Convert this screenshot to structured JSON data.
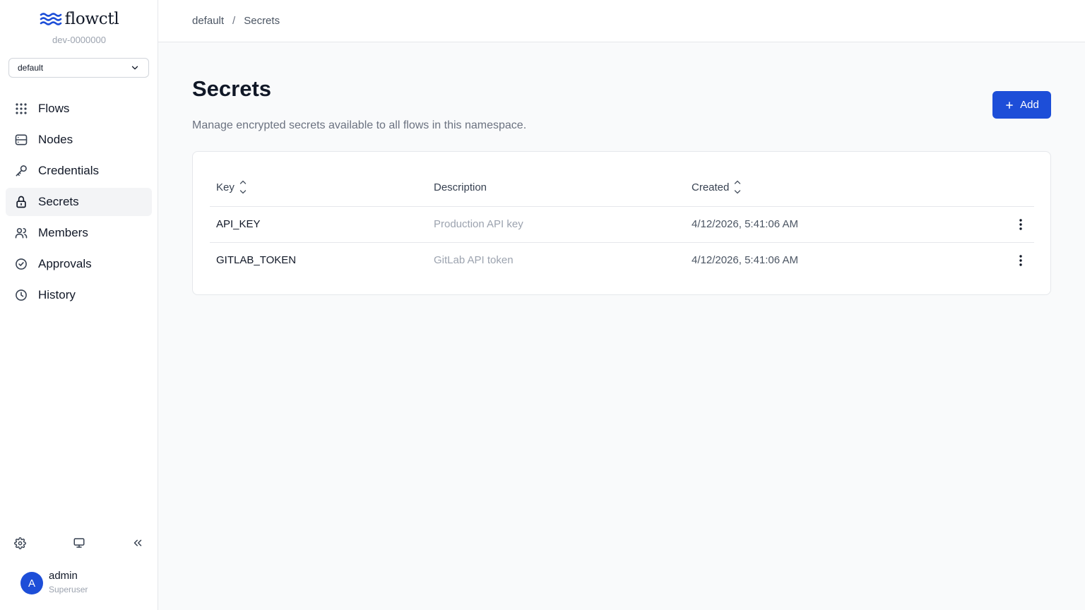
{
  "app": {
    "name": "flowctl",
    "instance": "dev-0000000"
  },
  "namespace_select": {
    "value": "default"
  },
  "nav": [
    {
      "label": "Flows",
      "icon": "grid-dots-icon"
    },
    {
      "label": "Nodes",
      "icon": "server-icon"
    },
    {
      "label": "Credentials",
      "icon": "key-icon"
    },
    {
      "label": "Secrets",
      "icon": "lock-icon",
      "active": true
    },
    {
      "label": "Members",
      "icon": "users-icon"
    },
    {
      "label": "Approvals",
      "icon": "check-circle-icon"
    },
    {
      "label": "History",
      "icon": "clock-icon"
    }
  ],
  "footer": {
    "icons": [
      "gear-icon",
      "monitor-icon",
      "collapse-sidebar-icon"
    ]
  },
  "user": {
    "initial": "A",
    "name": "admin",
    "role": "Superuser"
  },
  "breadcrumb": {
    "root": "default",
    "separator": "/",
    "current": "Secrets"
  },
  "page": {
    "title": "Secrets",
    "description": "Manage encrypted secrets available to all flows in this namespace.",
    "add_label": "Add"
  },
  "table": {
    "columns": {
      "key": "Key",
      "description": "Description",
      "created": "Created"
    },
    "rows": [
      {
        "key": "API_KEY",
        "description": "Production API key",
        "created": "4/12/2026, 5:41:06 AM"
      },
      {
        "key": "GITLAB_TOKEN",
        "description": "GitLab API token",
        "created": "4/12/2026, 5:41:06 AM"
      }
    ]
  },
  "colors": {
    "accent": "#1d4ed8",
    "active_nav_bg": "#f3f4f6",
    "page_bg": "#f9fafb"
  }
}
